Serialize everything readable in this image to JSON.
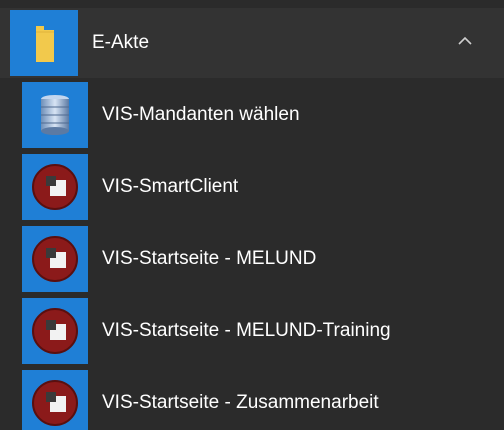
{
  "colors": {
    "background": "#2b2b2b",
    "header_background": "#333333",
    "tile": "#1f7fd6",
    "folder": "#f2c94c",
    "app_red": "#8b1a1a",
    "text": "#ffffff"
  },
  "group": {
    "label": "E-Akte",
    "icon": "folder-icon",
    "expanded_icon": "chevron-up-icon"
  },
  "items": [
    {
      "label": "VIS-Mandanten wählen",
      "icon": "server-icon"
    },
    {
      "label": "VIS-SmartClient",
      "icon": "vis-app-icon"
    },
    {
      "label": "VIS-Startseite - MELUND",
      "icon": "vis-app-icon"
    },
    {
      "label": "VIS-Startseite - MELUND-Training",
      "icon": "vis-app-icon"
    },
    {
      "label": "VIS-Startseite - Zusammenarbeit",
      "icon": "vis-app-icon"
    }
  ]
}
